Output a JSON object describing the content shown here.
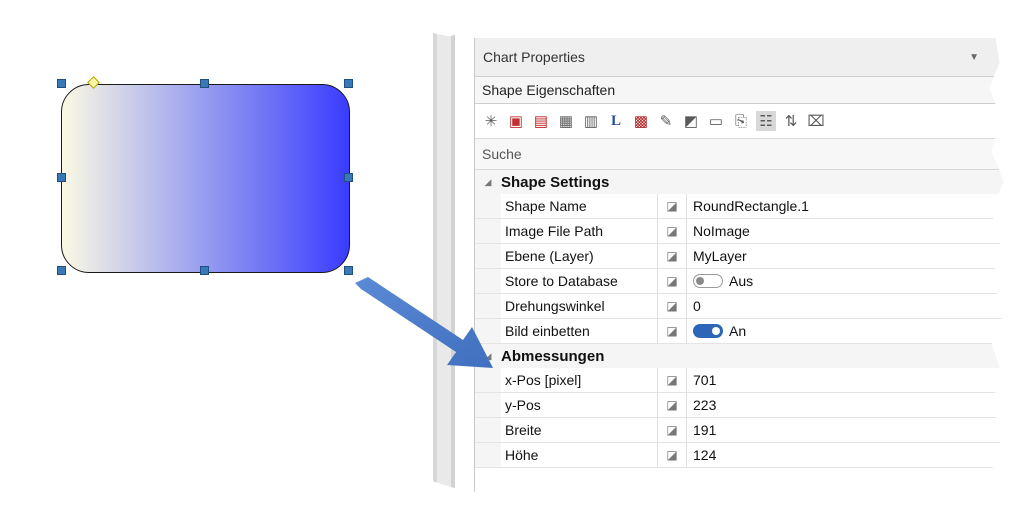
{
  "panel": {
    "title": "Chart Properties",
    "object_selector": "Shape Eigenschaften",
    "search_placeholder": "Suche"
  },
  "toolbar_icons": [
    "new-icon",
    "chart-icon",
    "fill-icon",
    "grid-lines-icon",
    "properties-icon",
    "label-L-icon",
    "table-icon",
    "folder-icon",
    "layers-icon",
    "sheet-icon",
    "copy-icon",
    "categorized-icon",
    "sort-az-icon",
    "collapse-icon"
  ],
  "categories": [
    {
      "label": "Shape Settings",
      "rows": [
        {
          "name": "Shape Name",
          "value": "RoundRectangle.1"
        },
        {
          "name": "Image File Path",
          "value": "NoImage"
        },
        {
          "name": "Ebene (Layer)",
          "value": "MyLayer"
        },
        {
          "name": "Store to Database",
          "value": "Aus",
          "toggle": "off"
        },
        {
          "name": "Drehungswinkel",
          "value": "0"
        },
        {
          "name": "Bild einbetten",
          "value": "An",
          "toggle": "on"
        }
      ]
    },
    {
      "label": "Abmessungen",
      "rows": [
        {
          "name": "x-Pos [pixel]",
          "value": "701"
        },
        {
          "name": "y-Pos",
          "value": "223"
        },
        {
          "name": "Breite",
          "value": "191"
        },
        {
          "name": "Höhe",
          "value": "124"
        }
      ]
    }
  ],
  "cut_label": "...en",
  "colors": {
    "toggle_on": "#2d66b8",
    "arrow": "#4a7bc8",
    "shape_end": "#3a3cff",
    "shape_start": "#fbf9e4"
  }
}
